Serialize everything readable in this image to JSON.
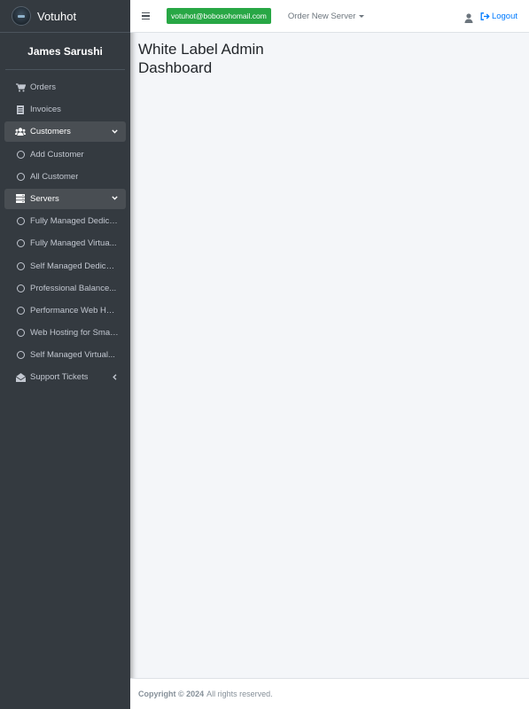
{
  "brand": {
    "name": "Votuhot"
  },
  "user": {
    "name": "James Sarushi"
  },
  "sidebar": {
    "items": [
      {
        "label": "Orders",
        "icon": "cart-icon"
      },
      {
        "label": "Invoices",
        "icon": "invoice-icon"
      },
      {
        "label": "Customers",
        "icon": "users-icon",
        "expanded": true
      },
      {
        "label": "Add Customer",
        "icon": "circle-icon"
      },
      {
        "label": "All Customer",
        "icon": "circle-icon"
      },
      {
        "label": "Servers",
        "icon": "server-icon",
        "expanded": true
      },
      {
        "label": "Fully Managed Dedica...",
        "icon": "circle-icon"
      },
      {
        "label": "Fully Managed Virtua...",
        "icon": "circle-icon"
      },
      {
        "label": "Self Managed Dedicat...",
        "icon": "circle-icon"
      },
      {
        "label": "Professional Balance...",
        "icon": "circle-icon"
      },
      {
        "label": "Performance Web Host...",
        "icon": "circle-icon"
      },
      {
        "label": "Web Hosting for Smal...",
        "icon": "circle-icon"
      },
      {
        "label": "Self Managed Virtual...",
        "icon": "circle-icon"
      },
      {
        "label": "Support Tickets",
        "icon": "envelope-open-icon",
        "expanded": false
      }
    ]
  },
  "topbar": {
    "email": "votuhot@bobosohomail.com",
    "order_label": "Order New Server",
    "logout_label": "Logout"
  },
  "main": {
    "title": "White Label Admin Dashboard"
  },
  "footer": {
    "copyright": "Copyright © 2024",
    "rights": "All rights reserved."
  },
  "colors": {
    "sidebar_bg": "#343a40",
    "email_badge": "#28a745",
    "link": "#007bff",
    "content_bg": "#f4f6f9"
  }
}
